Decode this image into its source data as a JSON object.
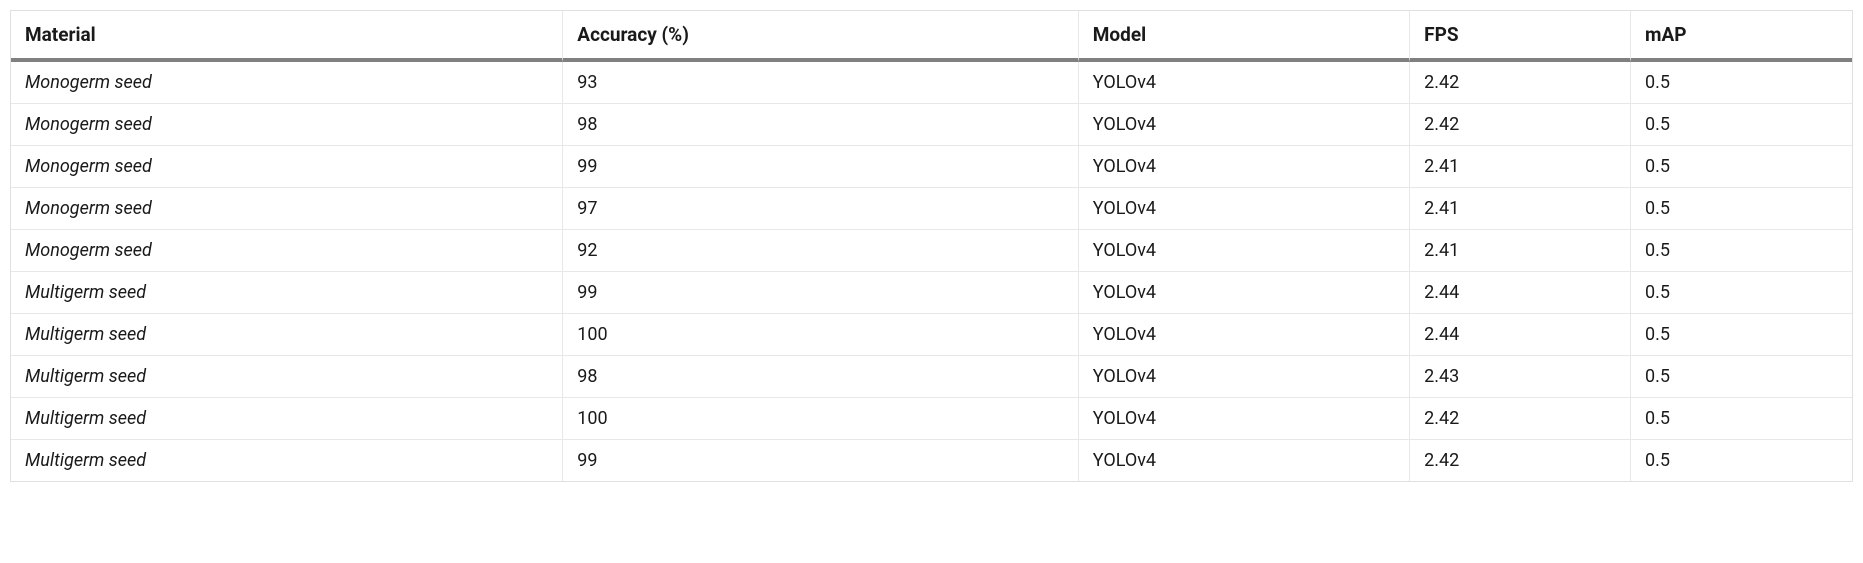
{
  "table": {
    "headers": {
      "material": "Material",
      "accuracy": "Accuracy (%)",
      "model": "Model",
      "fps": "FPS",
      "map": "mAP"
    },
    "rows": [
      {
        "material": "Monogerm seed",
        "accuracy": "93",
        "model": "YOLOv4",
        "fps": "2.42",
        "map": "0.5"
      },
      {
        "material": "Monogerm seed",
        "accuracy": "98",
        "model": "YOLOv4",
        "fps": "2.42",
        "map": "0.5"
      },
      {
        "material": "Monogerm seed",
        "accuracy": "99",
        "model": "YOLOv4",
        "fps": "2.41",
        "map": "0.5"
      },
      {
        "material": "Monogerm seed",
        "accuracy": "97",
        "model": "YOLOv4",
        "fps": "2.41",
        "map": "0.5"
      },
      {
        "material": "Monogerm seed",
        "accuracy": "92",
        "model": "YOLOv4",
        "fps": "2.41",
        "map": "0.5"
      },
      {
        "material": "Multigerm seed",
        "accuracy": "99",
        "model": "YOLOv4",
        "fps": "2.44",
        "map": "0.5"
      },
      {
        "material": "Multigerm seed",
        "accuracy": "100",
        "model": "YOLOv4",
        "fps": "2.44",
        "map": "0.5"
      },
      {
        "material": "Multigerm seed",
        "accuracy": "98",
        "model": "YOLOv4",
        "fps": "2.43",
        "map": "0.5"
      },
      {
        "material": "Multigerm seed",
        "accuracy": "100",
        "model": "YOLOv4",
        "fps": "2.42",
        "map": "0.5"
      },
      {
        "material": "Multigerm seed",
        "accuracy": "99",
        "model": "YOLOv4",
        "fps": "2.42",
        "map": "0.5"
      }
    ]
  }
}
